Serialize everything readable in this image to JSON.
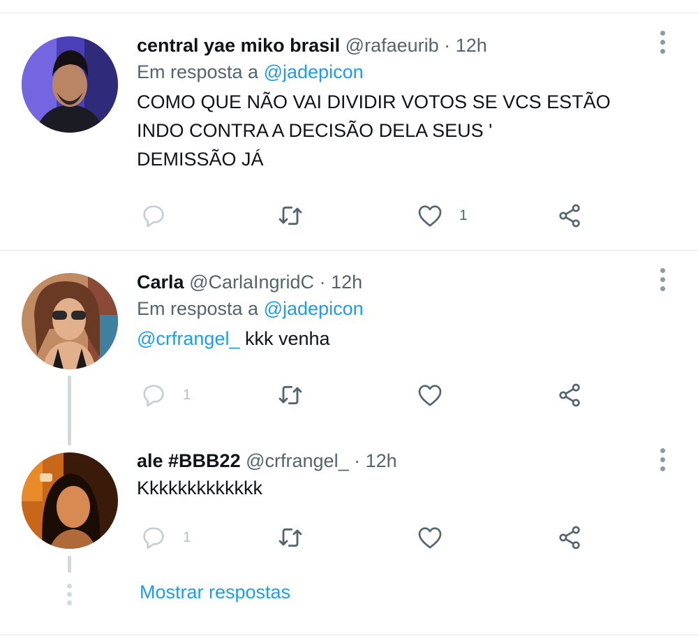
{
  "tweets": [
    {
      "name": "central yae miko brasil",
      "handle": "@rafaeurib",
      "dot": "·",
      "time": "12h",
      "reply_prefix": "Em resposta a",
      "reply_to": "@jadepicon",
      "text_lines": [
        "COMO QUE NÃO VAI DIVIDIR VOTOS SE VCS ESTÃO",
        "INDO CONTRA A DECISÃO DELA SEUS '",
        "DEMISSÃO JÁ"
      ],
      "reply_count": "",
      "like_count": "1"
    },
    {
      "name": "Carla",
      "handle": "@CarlaIngridC",
      "dot": "·",
      "time": "12h",
      "reply_prefix": "Em resposta a",
      "reply_to": "@jadepicon",
      "mention": "@crfrangel_",
      "text": " kkk venha",
      "reply_count": "1",
      "like_count": ""
    },
    {
      "name": "ale #BBB22",
      "handle": "@crfrangel_",
      "dot": "·",
      "time": "12h",
      "text": "Kkkkkkkkkkkkk",
      "reply_count": "1",
      "like_count": ""
    }
  ],
  "show_replies": "Mostrar respostas",
  "icons": {
    "reply": "reply-icon",
    "retweet": "retweet-icon",
    "like": "heart-icon",
    "share": "share-icon",
    "more": "more-vertical-icon"
  },
  "colors": {
    "link": "#1d9bf0",
    "secondary_text": "#536471",
    "icon": "#536471",
    "faded_icon": "#c5ced6",
    "divider": "#e3e6e9"
  }
}
